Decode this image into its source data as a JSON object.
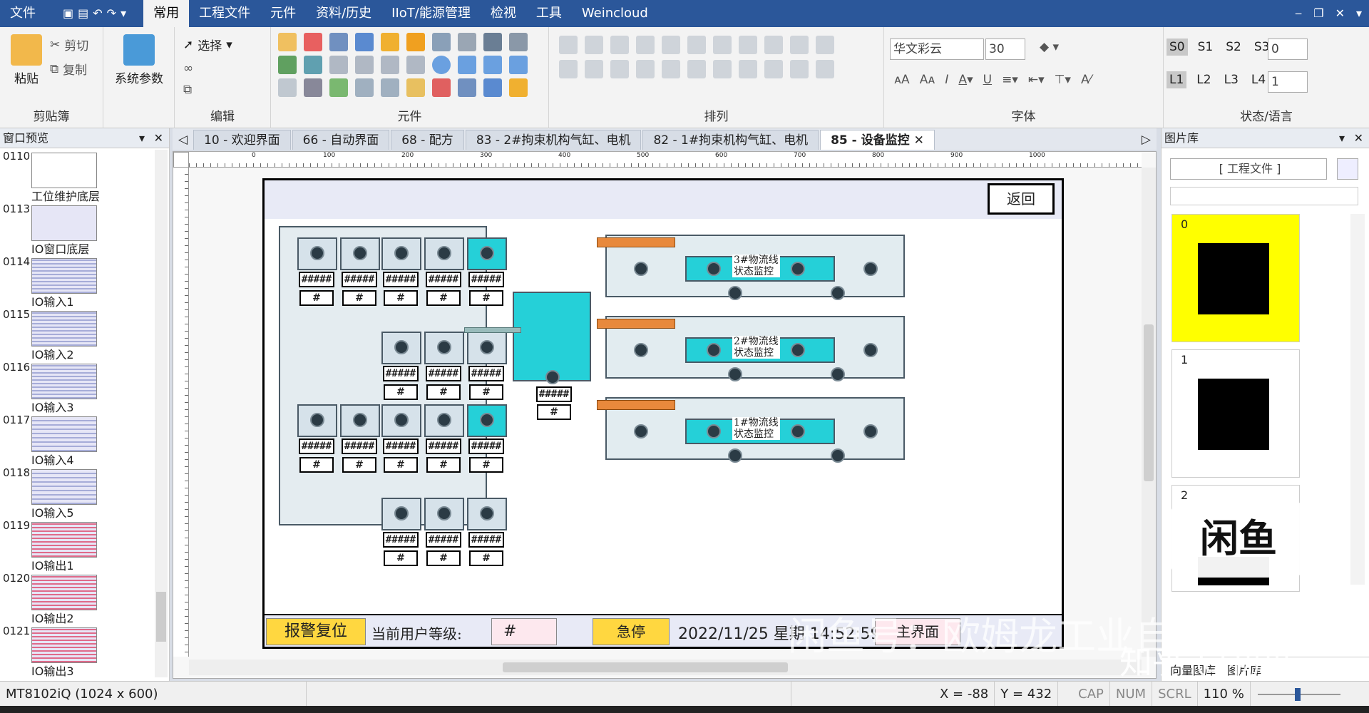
{
  "menu": {
    "file": "文件",
    "tabs": [
      "常用",
      "工程文件",
      "元件",
      "资料/历史",
      "IIoT/能源管理",
      "检视",
      "工具",
      "Weincloud"
    ],
    "active_tab": "常用"
  },
  "ribbon": {
    "clipboard": {
      "caption": "剪贴簿",
      "paste": "粘贴",
      "cut": "剪切",
      "copy": "复制"
    },
    "sysparams": {
      "label": "系统参数"
    },
    "edit": {
      "caption": "编辑",
      "select": "选择"
    },
    "elements": {
      "caption": "元件"
    },
    "arrange": {
      "caption": "排列"
    },
    "font": {
      "caption": "字体",
      "font_name": "华文彩云",
      "font_size": "30"
    },
    "state": {
      "caption": "状态/语言",
      "s_levels": [
        "S0",
        "S1",
        "S2",
        "S3"
      ],
      "s_value": "0",
      "l_levels": [
        "L1",
        "L2",
        "L3",
        "L4"
      ],
      "l_value": "1"
    }
  },
  "left_panel": {
    "title": "窗口预览",
    "items": [
      {
        "num": "0110",
        "label": "工位维护底层"
      },
      {
        "num": "0113",
        "label": "IO窗口底层"
      },
      {
        "num": "0114",
        "label": "IO输入1"
      },
      {
        "num": "0115",
        "label": "IO输入2"
      },
      {
        "num": "0116",
        "label": "IO输入3"
      },
      {
        "num": "0117",
        "label": "IO输入4"
      },
      {
        "num": "0118",
        "label": "IO输入5"
      },
      {
        "num": "0119",
        "label": "IO输出1"
      },
      {
        "num": "0120",
        "label": "IO输出2"
      },
      {
        "num": "0121",
        "label": "IO输出3"
      }
    ]
  },
  "doc_tabs": [
    {
      "label": "10 - 欢迎界面"
    },
    {
      "label": "66 - 自动界面"
    },
    {
      "label": "68 - 配方"
    },
    {
      "label": "83 - 2#拘束机构气缸、电机"
    },
    {
      "label": "82 - 1#拘束机构气缸、电机"
    },
    {
      "label": "85 - 设备监控",
      "active": true
    }
  ],
  "ruler": {
    "marks": [
      "0",
      "100",
      "200",
      "300",
      "400",
      "500",
      "600",
      "700",
      "800",
      "900",
      "1000"
    ]
  },
  "hmi": {
    "back": "返回",
    "hash_long": "#####",
    "hash_short": "#",
    "lines": [
      {
        "label": "3#物流线\n状态监控"
      },
      {
        "label": "2#物流线\n状态监控"
      },
      {
        "label": "1#物流线\n状态监控"
      }
    ],
    "alarm_reset": "报警复位",
    "user_level_label": "当前用户等级:",
    "user_level_value": "#",
    "estop": "急停",
    "datetime": "2022/11/25 星期 14:52:59",
    "main_screen": "主界面"
  },
  "right_panel": {
    "title": "图片库",
    "combo": "[ 工程文件 ]",
    "items": [
      "0",
      "1",
      "2"
    ],
    "bottom_tabs": [
      "向量图库",
      "图片库"
    ]
  },
  "status": {
    "model": "MT8102iQ (1024 x 600)",
    "x": "X = -88",
    "y": "Y = 432",
    "caps": "CAP",
    "num": "NUM",
    "scrl": "SCRL",
    "zoom": "110 %"
  },
  "watermarks": {
    "main": "闲鱼号：欧姆龙工业自动化",
    "zhihu": "知乎 @初见",
    "badge": "闲鱼"
  },
  "colors": {
    "title_bar": "#2b579a",
    "alarm_yellow": "#ffd740",
    "machine_cyan": "#25d0d8",
    "pic_highlight": "#ffff00"
  }
}
